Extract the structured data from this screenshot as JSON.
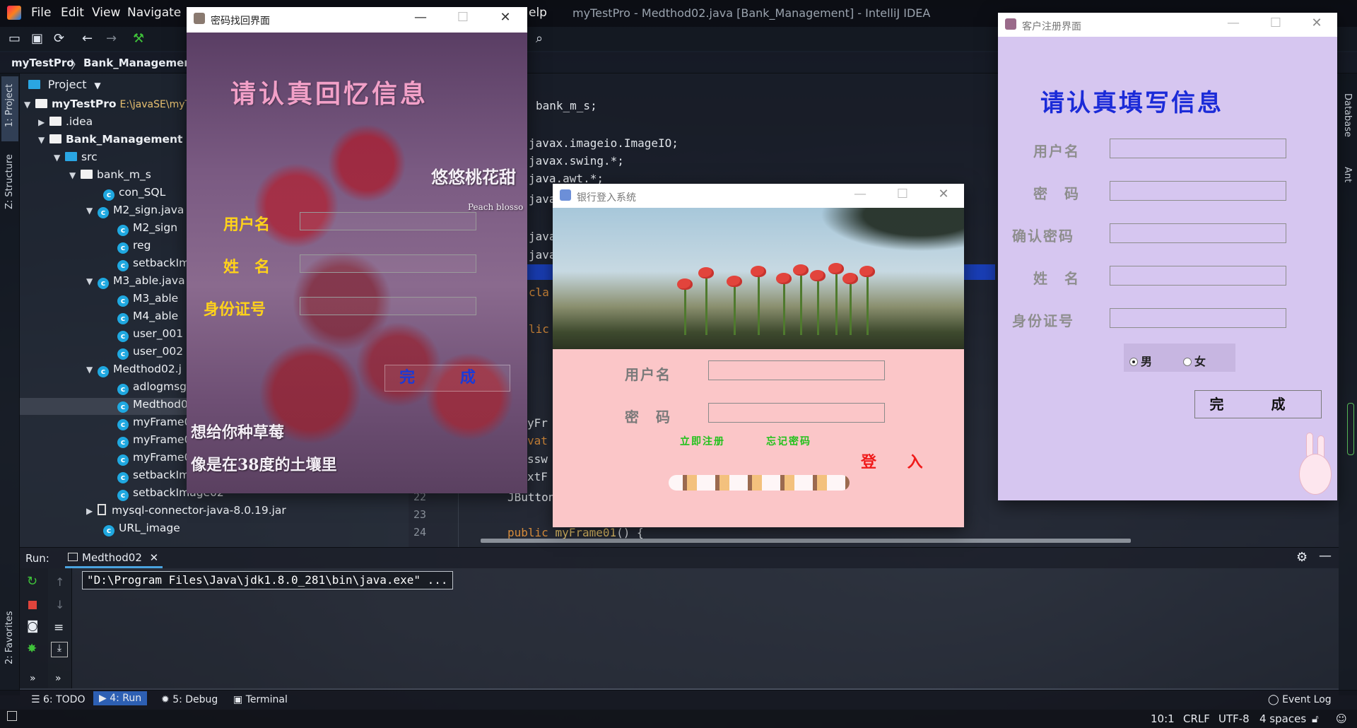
{
  "ide": {
    "menu": [
      "File",
      "Edit",
      "View",
      "Navigate",
      "elp"
    ],
    "title": "myTestPro - Medthod02.java [Bank_Management] - IntelliJ IDEA",
    "breadcrumb": [
      "myTestPro",
      "Bank_Management"
    ],
    "project_header": "Project",
    "left_stripe": [
      "1: Project",
      "Z: Structure",
      "2: Favorites"
    ],
    "right_stripe": [
      "Database",
      "Ant"
    ],
    "tree": [
      {
        "label": "myTestPro",
        "extra": "E:\\javaSE\\myT",
        "bold": true
      },
      {
        "label": ".idea"
      },
      {
        "label": "Bank_Management",
        "bold": true
      },
      {
        "label": "src"
      },
      {
        "label": "bank_m_s"
      },
      {
        "label": "con_SQL"
      },
      {
        "label": "M2_sign.java"
      },
      {
        "label": "M2_sign"
      },
      {
        "label": "reg"
      },
      {
        "label": "setbackIm"
      },
      {
        "label": "M3_able.java"
      },
      {
        "label": "M3_able"
      },
      {
        "label": "M4_able"
      },
      {
        "label": "user_001"
      },
      {
        "label": "user_002"
      },
      {
        "label": "Medthod02.j"
      },
      {
        "label": "adlogmsg"
      },
      {
        "label": "Medthod0"
      },
      {
        "label": "myFrame0"
      },
      {
        "label": "myFrame0"
      },
      {
        "label": "myFrame0"
      },
      {
        "label": "setbackIm"
      },
      {
        "label": "setbackImage02"
      },
      {
        "label": "mysql-connector-java-8.0.19.jar"
      },
      {
        "label": "URL_image"
      }
    ],
    "code": [
      "bank_m_s;",
      "javax.imageio.ImageIO;",
      "javax.swing.*;",
      "java.awt.*;",
      "java",
      "java",
      "java",
      "cla",
      "lic",
      "yFr",
      "vat",
      "ssw",
      "xtF",
      "JButton"
    ],
    "line_numbers": [
      "22",
      "23",
      "24"
    ],
    "code_line_24": {
      "kw": "public",
      "fn": "myFrame01",
      "rest": "() {"
    },
    "run": {
      "label": "Run:",
      "tab": "Medthod02",
      "command": "\"D:\\Program Files\\Java\\jdk1.8.0_281\\bin\\java.exe\" ..."
    },
    "bottom_tabs": [
      "6: TODO",
      "4: Run",
      "5: Debug",
      "Terminal"
    ],
    "event_log": "Event Log",
    "status": [
      "10:1",
      "CRLF",
      "UTF-8",
      "4 spaces"
    ]
  },
  "window_recover": {
    "title": "密码找回界面",
    "heading": "请认真回忆信息",
    "labels": [
      "用户名",
      "姓　名",
      "身份证号"
    ],
    "done": "完 成",
    "art_text": [
      "悠悠桃花甜",
      "Peach blosso",
      "想给你种草莓",
      "像是在38度的土壤里"
    ]
  },
  "window_login": {
    "title": "银行登入系统",
    "labels": [
      "用户名",
      "密　码"
    ],
    "register_link": "立即注册",
    "forgot_link": "忘记密码",
    "login": "登 入"
  },
  "window_register": {
    "title": "客户注册界面",
    "heading": "请认真填写信息",
    "labels": [
      "用户名",
      "密　码",
      "确认密码",
      "姓　名",
      "身份证号"
    ],
    "gender": {
      "male": "男",
      "female": "女",
      "selected": "male"
    },
    "done": "完 成"
  },
  "colors": {
    "recover_heading": "#f2a0c8",
    "recover_label": "#ffd21a",
    "recover_button": "#1a3ad8",
    "login_form_bg": "#fbc6c8",
    "login_link": "#21c21b",
    "login_button": "#f01a1a",
    "register_bg": "#d6c6f0",
    "register_heading": "#1b2bd8"
  }
}
